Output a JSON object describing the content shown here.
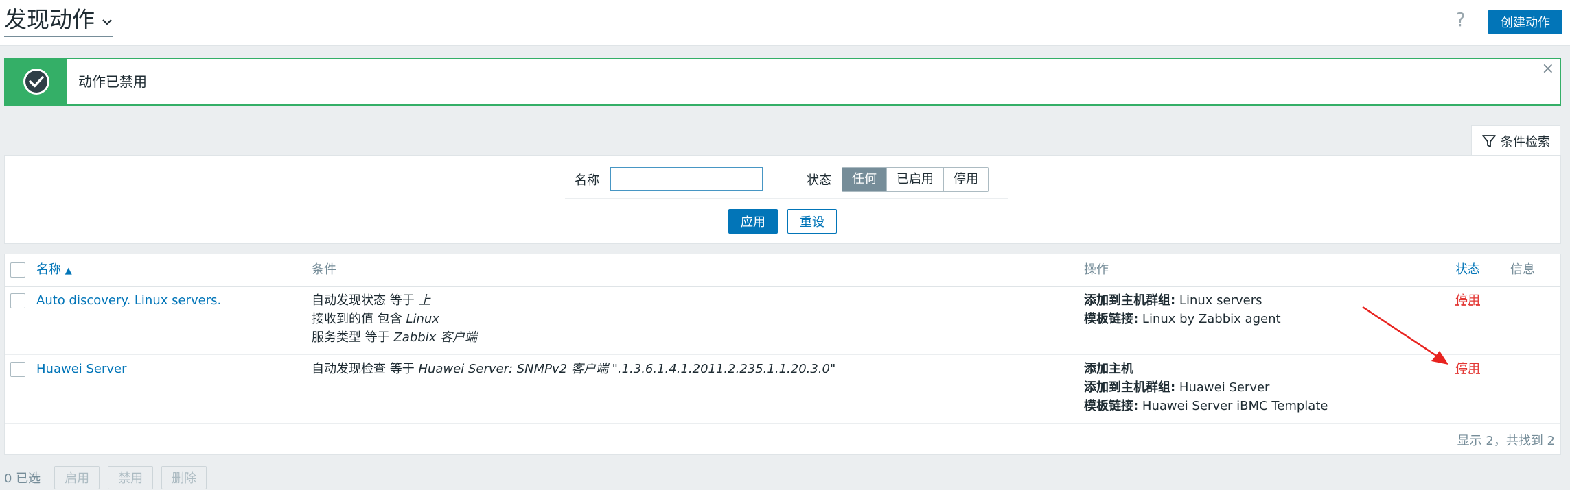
{
  "header": {
    "title": "发现动作",
    "help": "?",
    "create_label": "创建动作"
  },
  "message": {
    "text": "动作已禁用",
    "close": "×"
  },
  "filter": {
    "tab_label": "条件检索",
    "name_label": "名称",
    "name_value": "",
    "status_label": "状态",
    "status_options": [
      "任何",
      "已启用",
      "停用"
    ],
    "status_selected": "任何",
    "apply_label": "应用",
    "reset_label": "重设"
  },
  "table": {
    "columns": {
      "name": "名称",
      "sort_indicator": "▲",
      "conditions": "条件",
      "operations": "操作",
      "status": "状态",
      "info": "信息"
    },
    "rows": [
      {
        "name": "Auto discovery. Linux servers.",
        "conditions": [
          {
            "text": "自动发现状态 等于 ",
            "value": "上"
          },
          {
            "text": "接收到的值 包含 ",
            "value": "Linux"
          },
          {
            "text": "服务类型 等于 ",
            "value": "Zabbix 客户端"
          }
        ],
        "operations": [
          {
            "label": "添加到主机群组:",
            "value": " Linux servers"
          },
          {
            "label": "模板链接:",
            "value": " Linux by Zabbix agent"
          }
        ],
        "status": "停用"
      },
      {
        "name": "Huawei Server",
        "conditions": [
          {
            "text": "自动发现检查 等于 ",
            "value": "Huawei Server: SNMPv2 客户端 \".1.3.6.1.4.1.2011.2.235.1.1.20.3.0\""
          }
        ],
        "operations": [
          {
            "label": "添加主机",
            "value": ""
          },
          {
            "label": "添加到主机群组:",
            "value": " Huawei Server"
          },
          {
            "label": "模板链接:",
            "value": " Huawei Server iBMC Template"
          }
        ],
        "status": "停用"
      }
    ],
    "footer": "显示 2，共找到 2"
  },
  "bottom": {
    "selected": "0 已选",
    "enable_label": "启用",
    "disable_label": "禁用",
    "delete_label": "删除"
  },
  "colors": {
    "primary": "#0275b8",
    "success": "#34af67",
    "danger": "#e33734",
    "annotation_arrow": "#e8231f"
  }
}
